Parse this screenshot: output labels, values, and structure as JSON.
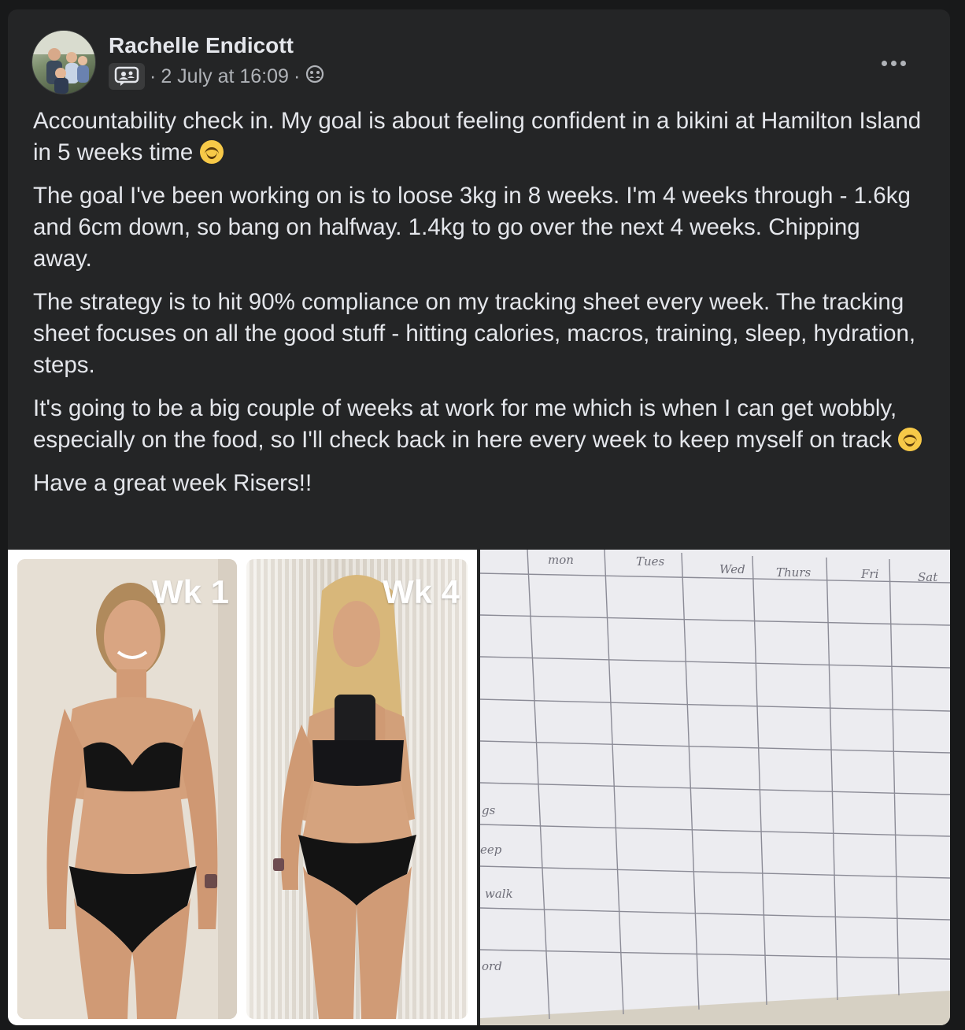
{
  "post": {
    "author": "Rachelle Endicott",
    "separator1": "·",
    "timestamp": "2 July at 16:09",
    "separator2": "·",
    "paragraphs": [
      "Accountability check in.  My goal is about feeling confident in a bikini at Hamilton Island in 5 weeks time",
      "The goal I've been working on is to loose 3kg in 8 weeks.  I'm 4 weeks through - 1.6kg and 6cm down, so bang on halfway.   1.4kg to go over the next 4 weeks.  Chipping away.",
      "The strategy is to hit 90% compliance on my tracking sheet every week.  The tracking sheet focuses on all the good stuff - hitting calories, macros, training, sleep, hydration, steps.",
      "It's going to be a big couple of weeks at work for me which is when I can get wobbly, especially on the food, so I'll check back in here every week to keep myself on track",
      "Have a great week Risers!!"
    ]
  },
  "photos": {
    "label_left": "Wk 1",
    "label_right": "Wk 4",
    "sheet_days": [
      "mon",
      "Tues",
      "Wed",
      "Thurs",
      "Fri",
      "Sat"
    ],
    "sheet_rows": [
      "gs",
      "eep",
      "walk",
      "",
      "ord"
    ]
  },
  "icons": {
    "group": "group-chat-icon",
    "audience": "members-audience-icon",
    "more": "more-options-icon",
    "emoji": "smiling-face-emoji"
  },
  "colors": {
    "background": "#18191a",
    "card": "#242526",
    "text": "#e4e6eb",
    "secondary_text": "#b0b3b8"
  }
}
